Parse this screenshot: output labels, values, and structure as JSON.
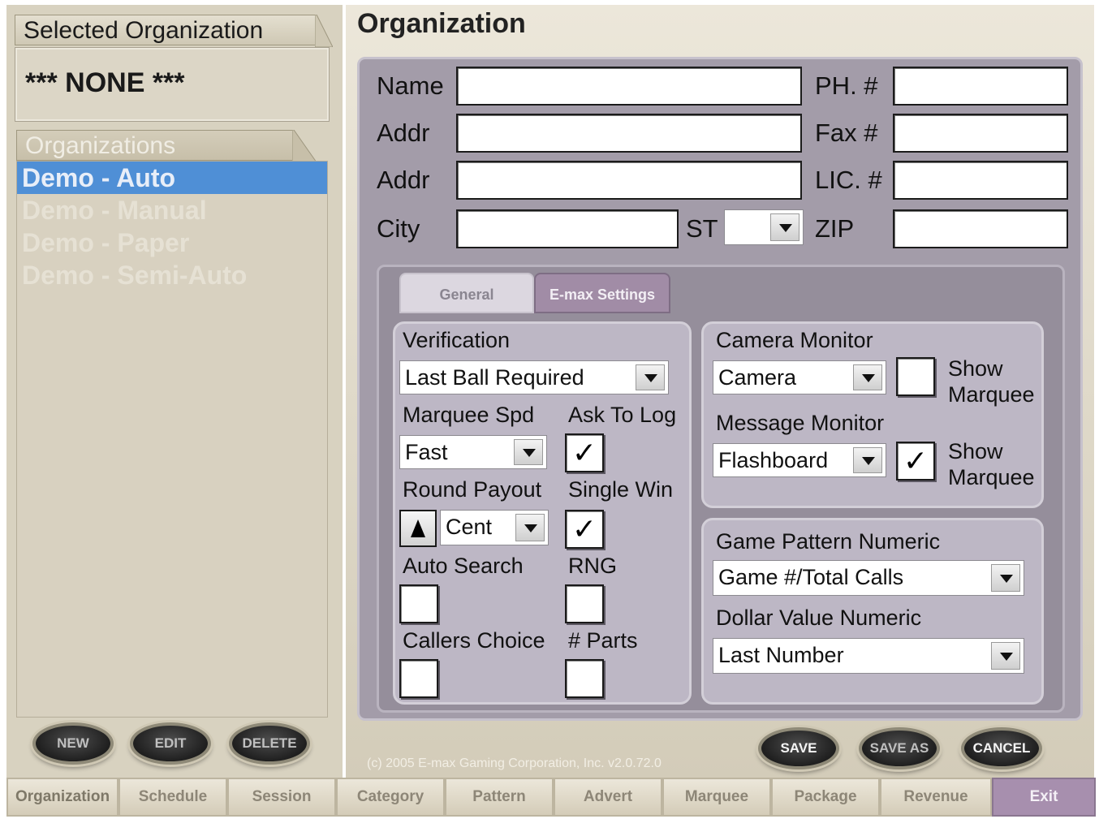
{
  "left": {
    "selected_header": "Selected Organization",
    "selected_value": "*** NONE ***",
    "orgs_header": "Organizations",
    "orgs": [
      "Demo - Auto",
      "Demo - Manual",
      "Demo - Paper",
      "Demo - Semi-Auto"
    ],
    "buttons": {
      "new": "NEW",
      "edit": "EDIT",
      "delete": "DELETE"
    }
  },
  "main": {
    "title": "Organization",
    "labels": {
      "name": "Name",
      "addr1": "Addr",
      "addr2": "Addr",
      "city": "City",
      "st": "ST",
      "phone": "PH. #",
      "fax": "Fax #",
      "lic": "LIC. #",
      "zip": "ZIP"
    },
    "fields": {
      "name": "",
      "addr1": "",
      "addr2": "",
      "city": "",
      "st": "",
      "phone": "",
      "fax": "",
      "lic": "",
      "zip": ""
    },
    "tabs": {
      "general": "General",
      "emax": "E-max Settings"
    },
    "settings": {
      "verification_label": "Verification",
      "verification_value": "Last Ball Required",
      "marquee_spd_label": "Marquee Spd",
      "marquee_spd_value": "Fast",
      "ask_to_log_label": "Ask To Log",
      "ask_to_log_checked": "✓",
      "round_payout_label": "Round Payout",
      "round_payout_value": "Cent",
      "single_win_label": "Single Win",
      "single_win_checked": "✓",
      "auto_search_label": "Auto Search",
      "rng_label": "RNG",
      "callers_choice_label": "Callers Choice",
      "parts_label": "# Parts",
      "camera_monitor_label": "Camera Monitor",
      "camera_value": "Camera",
      "show_marquee_1a": "Show",
      "show_marquee_1b": "Marquee",
      "message_monitor_label": "Message Monitor",
      "message_value": "Flashboard",
      "show_marquee_2a": "Show",
      "show_marquee_2b": "Marquee",
      "show_marquee_2_checked": "✓",
      "game_pattern_label": "Game Pattern Numeric",
      "game_pattern_value": "Game #/Total Calls",
      "dollar_value_label": "Dollar Value Numeric",
      "dollar_value_value": "Last Number"
    },
    "actions": {
      "save": "SAVE",
      "save_as": "SAVE AS",
      "cancel": "CANCEL"
    },
    "copyright": "(c) 2005 E-max Gaming Corporation, Inc. v2.0.72.0"
  },
  "nav": [
    "Organization",
    "Schedule",
    "Session",
    "Category",
    "Pattern",
    "Advert",
    "Marquee",
    "Package",
    "Revenue",
    "Exit"
  ]
}
